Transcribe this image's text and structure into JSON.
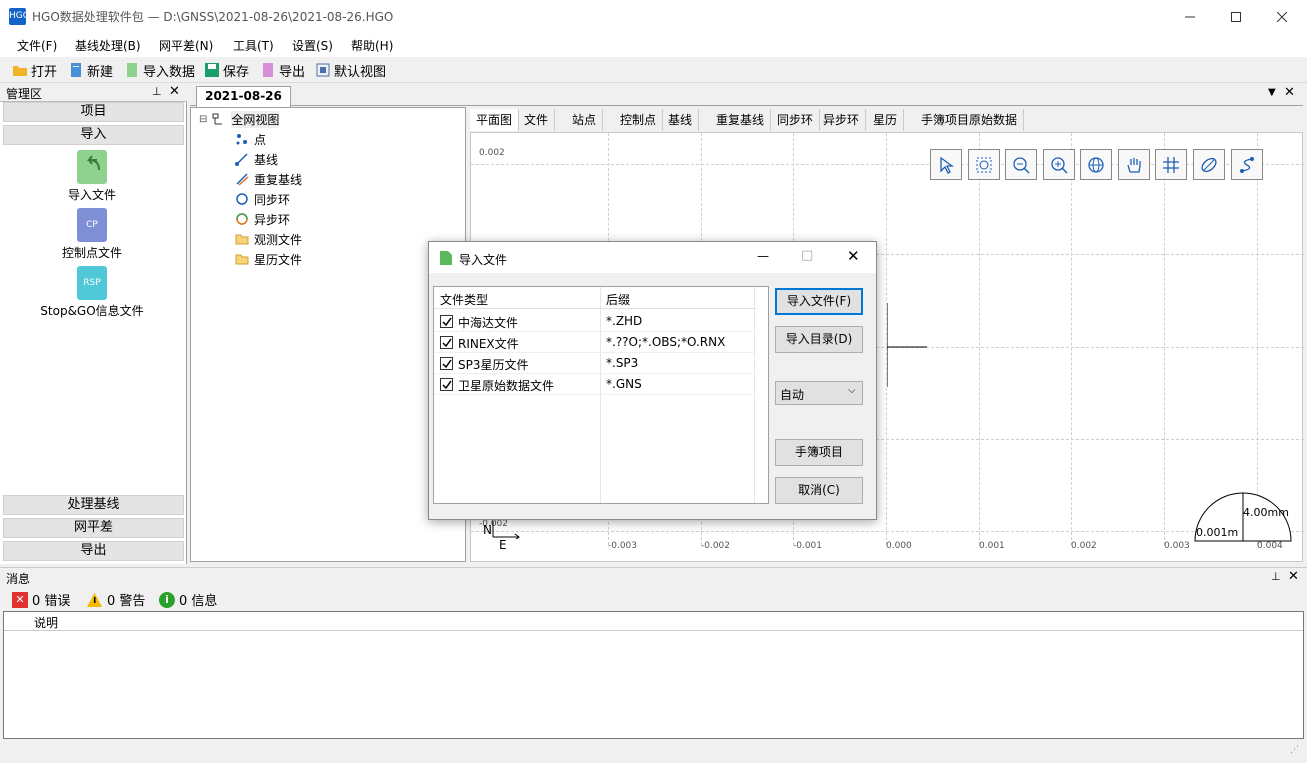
{
  "window": {
    "title": "HGO数据处理软件包 — D:\\GNSS\\2021-08-26\\2021-08-26.HGO",
    "icon_text": "HGO"
  },
  "menu": [
    "文件(F)",
    "基线处理(B)",
    "网平差(N)",
    "工具(T)",
    "设置(S)",
    "帮助(H)"
  ],
  "toolbar": [
    "打开",
    "新建",
    "导入数据",
    "保存",
    "导出",
    "默认视图"
  ],
  "left_panel": {
    "title": "管理区",
    "sections_top": [
      "项目",
      "导入"
    ],
    "items": [
      {
        "label": "导入文件",
        "badge": ""
      },
      {
        "label": "控制点文件",
        "badge": "CP"
      },
      {
        "label": "Stop&GO信息文件",
        "badge": "RSP"
      }
    ],
    "sections_bottom": [
      "处理基线",
      "网平差",
      "导出"
    ]
  },
  "doc_tab": "2021-08-26",
  "tree": {
    "root": "全网视图",
    "children": [
      "点",
      "基线",
      "重复基线",
      "同步环",
      "异步环",
      "观测文件",
      "星历文件"
    ]
  },
  "view_tabs": [
    "平面图",
    "文件",
    "站点",
    "控制点",
    "基线",
    "重复基线",
    "同步环",
    "异步环",
    "星历",
    "手簿项目原始数据"
  ],
  "plot": {
    "y_top": "0.002",
    "y_bottom": "-0.002",
    "x_ticks": [
      "-0.003",
      "-0.002",
      "-0.001",
      "0.000",
      "0.001",
      "0.002",
      "0.003",
      "0.004"
    ],
    "north": "N",
    "east": "E",
    "scale_ellipse": "4.00mm",
    "scale_len": "0.001m"
  },
  "plot_tools": [
    "pointer-icon",
    "zoom-box-icon",
    "zoom-out-icon",
    "zoom-in-icon",
    "globe-icon",
    "pan-hand-icon",
    "grid-icon",
    "ellipse-icon",
    "network-icon"
  ],
  "dialog": {
    "title": "导入文件",
    "col_type": "文件类型",
    "col_suffix": "后缀",
    "rows": [
      {
        "type": "中海达文件",
        "suffix": "*.ZHD",
        "checked": true
      },
      {
        "type": "RINEX文件",
        "suffix": "*.??O;*.OBS;*O.RNX",
        "checked": true
      },
      {
        "type": "SP3星历文件",
        "suffix": "*.SP3",
        "checked": true
      },
      {
        "type": "卫星原始数据文件",
        "suffix": "*.GNS",
        "checked": true
      }
    ],
    "btn_import_file": "导入文件(F)",
    "btn_import_dir": "导入目录(D)",
    "select_value": "自动",
    "btn_handbook": "手簿项目",
    "btn_cancel": "取消(C)"
  },
  "messages": {
    "title": "消息",
    "errors": "0 错误",
    "warnings": "0 警告",
    "infos": "0 信息",
    "col_desc": "说明"
  }
}
